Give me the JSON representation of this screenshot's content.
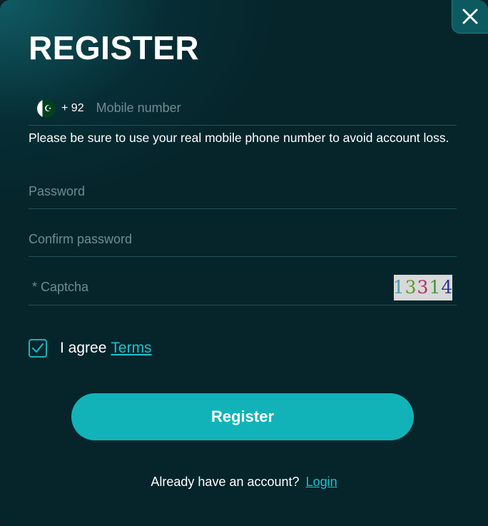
{
  "modal": {
    "title": "REGISTER",
    "close_icon": "close-icon"
  },
  "phone": {
    "flag_icon": "pakistan-flag-icon",
    "country_code": "+ 92",
    "placeholder": "Mobile number",
    "value": ""
  },
  "hint": "Please be sure to use your real mobile phone number to avoid account loss.",
  "password": {
    "placeholder": "Password",
    "value": ""
  },
  "confirm_password": {
    "placeholder": "Confirm password",
    "value": ""
  },
  "captcha": {
    "placeholder": "* Captcha",
    "value": "",
    "image_digits": [
      {
        "char": "1",
        "color": "#3aa0b8"
      },
      {
        "char": "3",
        "color": "#5a9a2a"
      },
      {
        "char": "3",
        "color": "#b0306a"
      },
      {
        "char": "1",
        "color": "#3a9a3a"
      },
      {
        "char": "4",
        "color": "#2a3a8a"
      }
    ]
  },
  "agree": {
    "checked": true,
    "label": "I agree",
    "terms_link": "Terms"
  },
  "register_button": "Register",
  "footer": {
    "text": "Already have an account?",
    "login_link": "Login"
  },
  "colors": {
    "accent": "#11b3b9",
    "link": "#19c3cf",
    "background": "#05252b"
  }
}
